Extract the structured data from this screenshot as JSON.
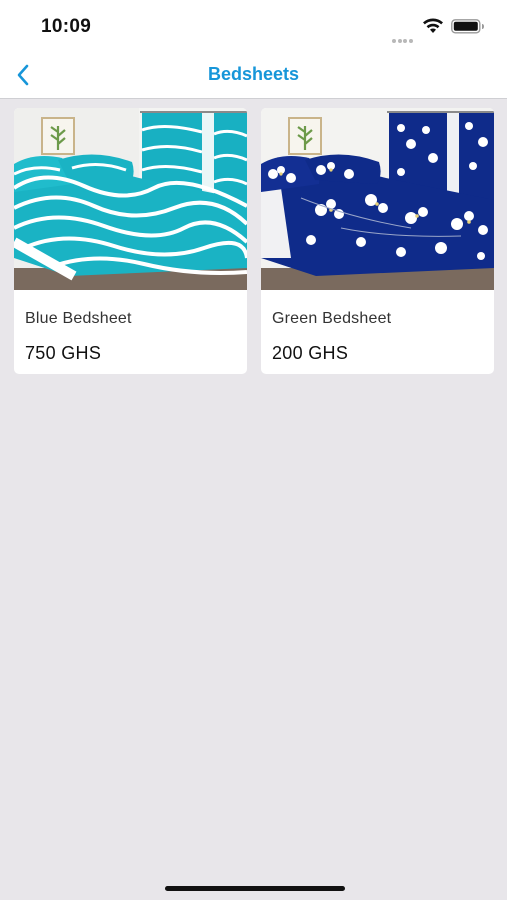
{
  "status_bar": {
    "time": "10:09",
    "icons": [
      "signal-dots-icon",
      "wifi-icon",
      "battery-icon"
    ]
  },
  "nav": {
    "title": "Bedsheets",
    "back_icon": "chevron-left-icon"
  },
  "colors": {
    "accent": "#1796d9",
    "background": "#e8e6ea",
    "card": "#ffffff"
  },
  "products": [
    {
      "name": "Blue Bedsheet",
      "price": "750 GHS",
      "image_icon": "bedsheet-photo-icon",
      "image_colors": [
        "#1ab3c4",
        "#ffffff"
      ]
    },
    {
      "name": "Green Bedsheet",
      "price": "200 GHS",
      "image_icon": "bedsheet-photo-icon",
      "image_colors": [
        "#0f2b8a",
        "#ffffff"
      ]
    }
  ]
}
